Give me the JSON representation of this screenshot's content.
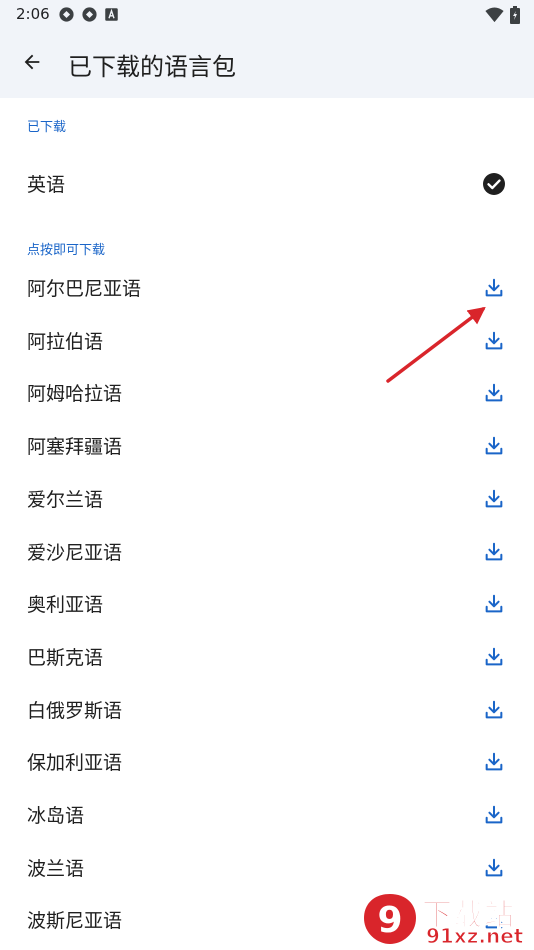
{
  "status_bar": {
    "time": "2:06",
    "left_icons": [
      "sync-icon",
      "sync-icon",
      "text-icon"
    ],
    "right_icons": [
      "wifi-icon",
      "battery-icon"
    ]
  },
  "app_bar": {
    "back_icon": "arrow-left-icon",
    "title": "已下载的语言包"
  },
  "downloaded": {
    "header": "已下载",
    "items": [
      {
        "label": "英语",
        "icon": "check-circle-icon"
      }
    ]
  },
  "available": {
    "header": "点按即可下载",
    "items": [
      {
        "label": "阿尔巴尼亚语",
        "icon": "download-icon"
      },
      {
        "label": "阿拉伯语",
        "icon": "download-icon"
      },
      {
        "label": "阿姆哈拉语",
        "icon": "download-icon"
      },
      {
        "label": "阿塞拜疆语",
        "icon": "download-icon"
      },
      {
        "label": "爱尔兰语",
        "icon": "download-icon"
      },
      {
        "label": "爱沙尼亚语",
        "icon": "download-icon"
      },
      {
        "label": "奥利亚语",
        "icon": "download-icon"
      },
      {
        "label": "巴斯克语",
        "icon": "download-icon"
      },
      {
        "label": "白俄罗斯语",
        "icon": "download-icon"
      },
      {
        "label": "保加利亚语",
        "icon": "download-icon"
      },
      {
        "label": "冰岛语",
        "icon": "download-icon"
      },
      {
        "label": "波兰语",
        "icon": "download-icon"
      },
      {
        "label": "波斯尼亚语",
        "icon": "download-icon"
      }
    ]
  },
  "colors": {
    "accent": "#1a65c8",
    "header_bg": "#f1f4f9",
    "annotation": "#d9252b"
  },
  "watermark": {
    "logo_text": "9",
    "main": "下载站",
    "sub": "91xz.net"
  }
}
